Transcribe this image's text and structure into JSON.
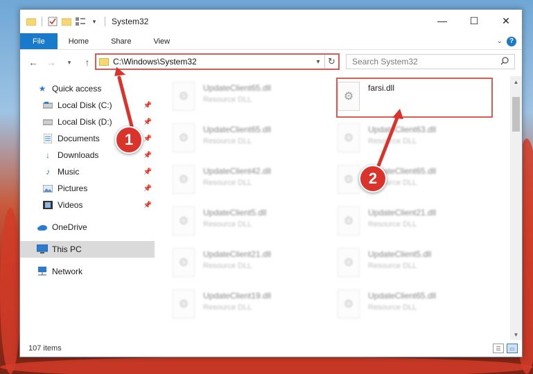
{
  "window": {
    "title": "System32"
  },
  "window_controls": {
    "minimize": "—",
    "maximize": "☐",
    "close": "✕"
  },
  "ribbon": {
    "tabs": [
      "File",
      "Home",
      "Share",
      "View"
    ],
    "help": "?"
  },
  "navbar": {
    "address": "C:\\Windows\\System32",
    "search_placeholder": "Search System32"
  },
  "sidebar": {
    "quick_access": "Quick access",
    "items": [
      {
        "label": "Local Disk (C:)",
        "icon": "drive-icon"
      },
      {
        "label": "Local Disk (D:)",
        "icon": "drive-icon"
      },
      {
        "label": "Documents",
        "icon": "documents-icon"
      },
      {
        "label": "Downloads",
        "icon": "downloads-icon"
      },
      {
        "label": "Music",
        "icon": "music-icon"
      },
      {
        "label": "Pictures",
        "icon": "pictures-icon"
      },
      {
        "label": "Videos",
        "icon": "videos-icon"
      }
    ],
    "onedrive": "OneDrive",
    "this_pc": "This PC",
    "network": "Network"
  },
  "files": {
    "left": [
      {
        "name": "UpdateClient65.dll",
        "type": "Resource DLL"
      },
      {
        "name": "UpdateClient65.dll",
        "type": "Resource DLL"
      },
      {
        "name": "UpdateClient42.dll",
        "type": "Resource DLL"
      },
      {
        "name": "UpdateClient5.dll",
        "type": "Resource DLL"
      },
      {
        "name": "UpdateClient21.dll",
        "type": "Resource DLL"
      },
      {
        "name": "UpdateClient19.dll",
        "type": "Resource DLL"
      }
    ],
    "right": [
      {
        "name": "farsi.dll",
        "type": ""
      },
      {
        "name": "UpdateClient63.dll",
        "type": "Resource DLL"
      },
      {
        "name": "UpdateClient65.dll",
        "type": "Resource DLL"
      },
      {
        "name": "UpdateClient21.dll",
        "type": "Resource DLL"
      },
      {
        "name": "UpdateClient5.dll",
        "type": "Resource DLL"
      },
      {
        "name": "UpdateClient65.dll",
        "type": "Resource DLL"
      }
    ]
  },
  "status": {
    "count": "107 items"
  },
  "annotations": {
    "badge1": "1",
    "badge2": "2"
  },
  "colors": {
    "accent": "#1979ca",
    "highlight": "#e05a55",
    "badge": "#d9332c"
  }
}
